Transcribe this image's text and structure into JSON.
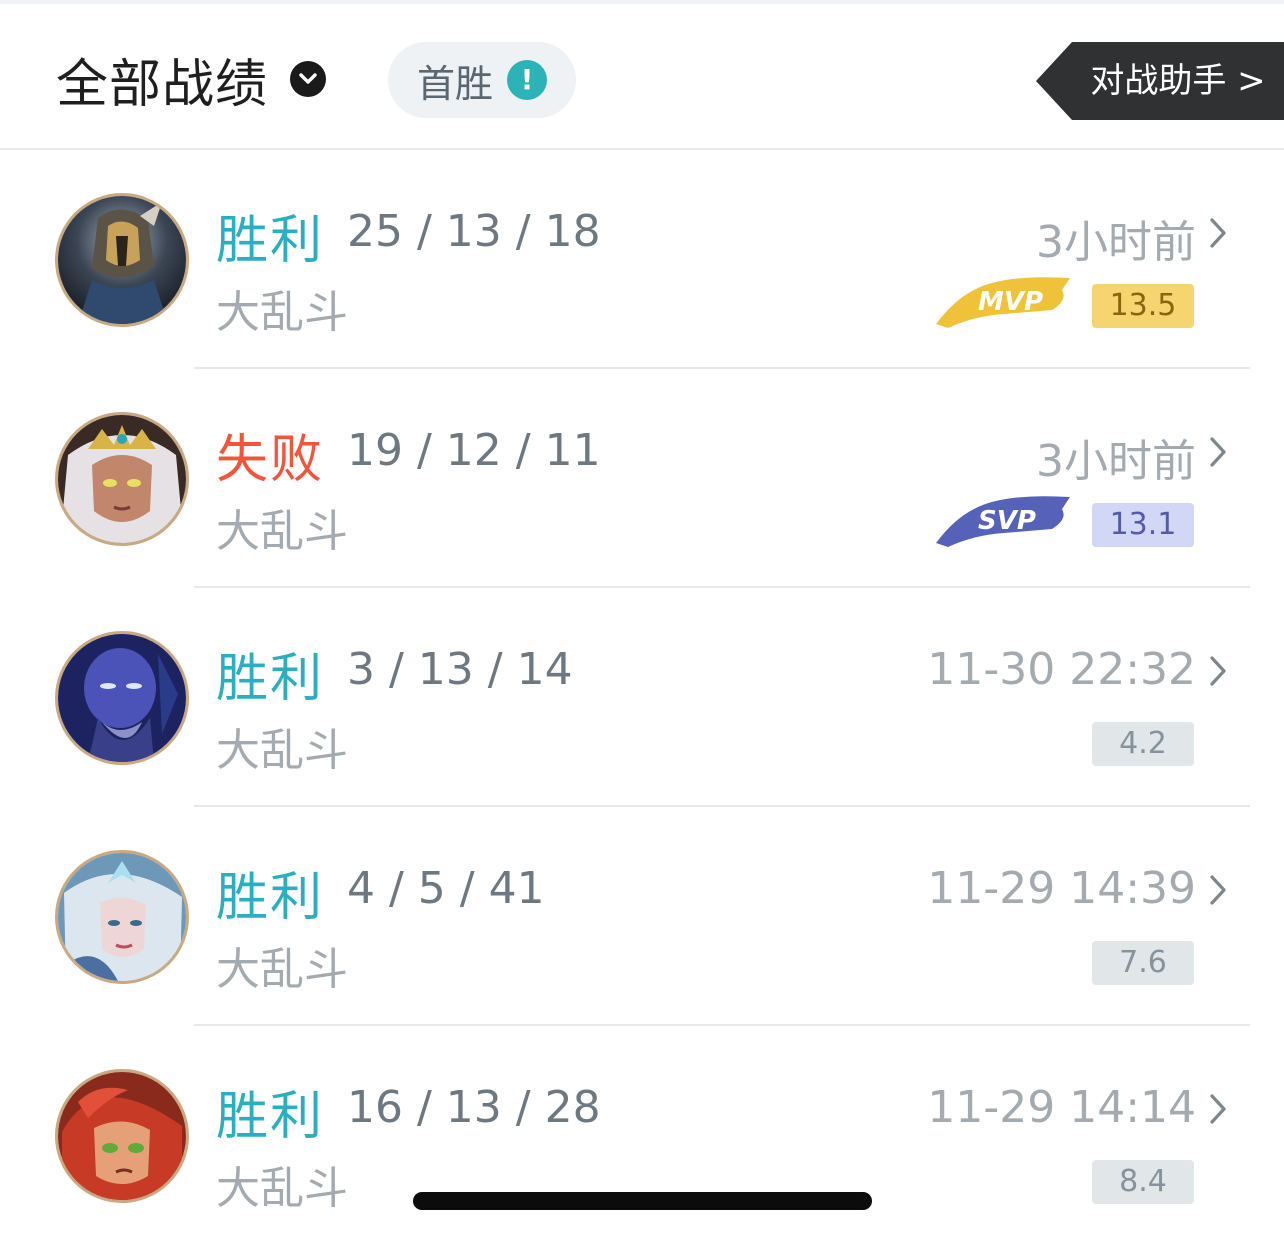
{
  "header": {
    "filter_label": "全部战绩",
    "chip_label": "首胜",
    "chip_info_icon": "!",
    "assistant_label": "对战助手 >"
  },
  "colors": {
    "win": "#2aafc0",
    "loss": "#f2553b",
    "mvp_gold": "#f0c23a",
    "svp_purple": "#5662b8",
    "assistant_bg": "#2f3132"
  },
  "matches": [
    {
      "result": "胜利",
      "kda": "25 / 13 / 18",
      "mode": "大乱斗",
      "time": "3小时前",
      "badge": "MVP",
      "score": "13.5",
      "avatar_icon": "armored-knight-hero-avatar"
    },
    {
      "result": "失败",
      "kda": "19 / 12 / 11",
      "mode": "大乱斗",
      "time": "3小时前",
      "badge": "SVP",
      "score": "13.1",
      "avatar_icon": "crowned-queen-hero-avatar"
    },
    {
      "result": "胜利",
      "kda": "3 / 13 / 14",
      "mode": "大乱斗",
      "time": "11-30 22:32",
      "badge": "",
      "score": "4.2",
      "avatar_icon": "blue-monk-hero-avatar"
    },
    {
      "result": "胜利",
      "kda": "4 / 5 / 41",
      "mode": "大乱斗",
      "time": "11-29 14:39",
      "badge": "",
      "score": "7.6",
      "avatar_icon": "ice-mage-hero-avatar"
    },
    {
      "result": "胜利",
      "kda": "16 / 13 / 28",
      "mode": "大乱斗",
      "time": "11-29 14:14",
      "badge": "",
      "score": "8.4",
      "avatar_icon": "red-haired-girl-hero-avatar"
    }
  ]
}
